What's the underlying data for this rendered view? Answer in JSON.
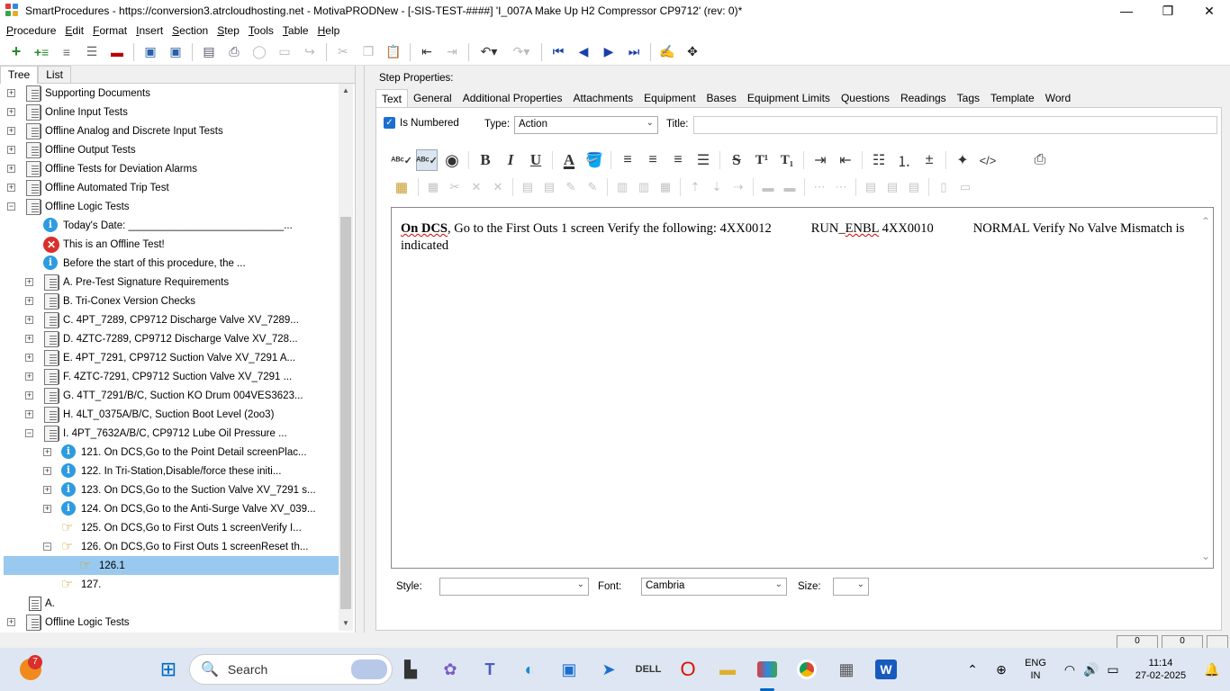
{
  "window": {
    "title": "SmartProcedures - https://conversion3.atrcloudhosting.net - MotivaPRODNew - [-SIS-TEST-####] 'I_007A Make Up H2 Compressor CP9712' (rev: 0)*",
    "minimize": "—",
    "maximize": "❐",
    "close": "✕"
  },
  "menu": {
    "items": [
      {
        "label": "Procedure"
      },
      {
        "label": "Edit"
      },
      {
        "label": "Format"
      },
      {
        "label": "Insert"
      },
      {
        "label": "Section"
      },
      {
        "label": "Step"
      },
      {
        "label": "Tools"
      },
      {
        "label": "Table"
      },
      {
        "label": "Help"
      }
    ]
  },
  "toolbar": {
    "icons": [
      "add-icon",
      "add-child-icon",
      "document-icon",
      "document-lines-icon",
      "remove-icon",
      "save-all-icon",
      "save-icon",
      "print-setup-icon",
      "print-icon",
      "refresh-icon",
      "window-icon",
      "redo-disabled-icon",
      "cut-icon",
      "copy-icon",
      "paste-icon",
      "indent-icon",
      "outdent-icon",
      "undo-icon",
      "redo-icon",
      "first-icon",
      "previous-icon",
      "next-icon",
      "last-icon",
      "spellcheck-icon",
      "move-icon"
    ]
  },
  "left_pane": {
    "tabs": [
      {
        "label": "Tree",
        "active": true
      },
      {
        "label": "List",
        "active": false
      }
    ],
    "tree": [
      {
        "label": "Supporting Documents",
        "level": 0,
        "icon": "document-stack-icon",
        "expander": "+"
      },
      {
        "label": "Online Input Tests",
        "level": 0,
        "icon": "document-stack-icon",
        "expander": "+"
      },
      {
        "label": "Offline Analog and Discrete Input Tests",
        "level": 0,
        "icon": "document-stack-icon",
        "expander": "+"
      },
      {
        "label": "Offline Output Tests",
        "level": 0,
        "icon": "document-stack-icon",
        "expander": "+"
      },
      {
        "label": "Offline Tests for Deviation Alarms",
        "level": 0,
        "icon": "document-stack-icon",
        "expander": "+"
      },
      {
        "label": "Offline Automated Trip Test",
        "level": 0,
        "icon": "document-stack-icon",
        "expander": "+"
      },
      {
        "label": "Offline Logic Tests",
        "level": 0,
        "icon": "document-stack-icon",
        "expander": "−"
      },
      {
        "label": "Today's Date: ___________________________...",
        "level": 1,
        "icon": "info-icon",
        "expander": ""
      },
      {
        "label": "This is an Offline Test!",
        "level": 1,
        "icon": "error-icon",
        "expander": ""
      },
      {
        "label": "Before the start of this procedure, the ...",
        "level": 1,
        "icon": "info-icon",
        "expander": ""
      },
      {
        "label": "A. Pre-Test Signature Requirements",
        "level": 1,
        "icon": "document-stack-icon",
        "expander": "+"
      },
      {
        "label": "B. Tri-Conex Version Checks",
        "level": 1,
        "icon": "document-stack-icon",
        "expander": "+"
      },
      {
        "label": "C. 4PT_7289, CP9712 Discharge Valve XV_7289...",
        "level": 1,
        "icon": "document-stack-icon",
        "expander": "+"
      },
      {
        "label": "D. 4ZTC-7289, CP9712 Discharge Valve XV_728...",
        "level": 1,
        "icon": "document-stack-icon",
        "expander": "+"
      },
      {
        "label": "E. 4PT_7291, CP9712 Suction Valve XV_7291 A...",
        "level": 1,
        "icon": "document-stack-icon",
        "expander": "+"
      },
      {
        "label": "F. 4ZTC-7291, CP9712 Suction Valve XV_7291 ...",
        "level": 1,
        "icon": "document-stack-icon",
        "expander": "+"
      },
      {
        "label": "G. 4TT_7291/B/C, Suction KO Drum 004VES3623...",
        "level": 1,
        "icon": "document-stack-icon",
        "expander": "+"
      },
      {
        "label": "H. 4LT_0375A/B/C, Suction Boot Level (2oo3)",
        "level": 1,
        "icon": "document-stack-icon",
        "expander": "+"
      },
      {
        "label": "I. 4PT_7632A/B/C, CP9712 Lube Oil Pressure ...",
        "level": 1,
        "icon": "document-stack-icon",
        "expander": "−"
      },
      {
        "label": "121. On DCS,Go to the Point Detail screenPlac...",
        "level": 2,
        "icon": "info-icon",
        "expander": "+"
      },
      {
        "label": "122. In Tri-Station,Disable/force these initi...",
        "level": 2,
        "icon": "info-icon",
        "expander": "+"
      },
      {
        "label": "123. On DCS,Go to the Suction Valve XV_7291 s...",
        "level": 2,
        "icon": "info-icon",
        "expander": "+"
      },
      {
        "label": "124. On DCS,Go to the Anti-Surge Valve XV_039...",
        "level": 2,
        "icon": "info-icon",
        "expander": "+"
      },
      {
        "label": "125. On DCS,Go to First Outs 1 screenVerify I...",
        "level": 2,
        "icon": "action-hand-icon",
        "expander": ""
      },
      {
        "label": "126. On DCS,Go to First Outs 1 screenReset th...",
        "level": 2,
        "icon": "action-hand-icon",
        "expander": "−"
      },
      {
        "label": "126.1",
        "level": 3,
        "icon": "action-hand-icon",
        "expander": "",
        "selected": true
      },
      {
        "label": "127.",
        "level": 2,
        "icon": "action-hand-icon",
        "expander": ""
      },
      {
        "label": "A.",
        "level": 0,
        "icon": "document-icon",
        "expander": ""
      },
      {
        "label": "Offline Logic Tests",
        "level": 0,
        "icon": "document-stack-icon",
        "expander": "+"
      }
    ]
  },
  "step_properties": {
    "label": "Step Properties:",
    "tabs": [
      {
        "label": "Text",
        "active": true
      },
      {
        "label": "General"
      },
      {
        "label": "Additional Properties"
      },
      {
        "label": "Attachments"
      },
      {
        "label": "Equipment"
      },
      {
        "label": "Bases"
      },
      {
        "label": "Equipment Limits"
      },
      {
        "label": "Questions"
      },
      {
        "label": "Readings"
      },
      {
        "label": "Tags"
      },
      {
        "label": "Template"
      },
      {
        "label": "Word"
      }
    ],
    "is_numbered": {
      "label": "Is Numbered",
      "checked": true
    },
    "type": {
      "label": "Type:",
      "value": "Action"
    },
    "title": {
      "label": "Title:",
      "value": ""
    },
    "editor_toolbar": {
      "bold": "B",
      "italic": "I",
      "underline": "U",
      "font_color": "A",
      "strike": "S",
      "superscript": "T¹",
      "subscript": "T₁",
      "code": "</>"
    },
    "editor": {
      "bold_lead": "On DCS",
      "text_after_lead": ", Go to the First Outs 1 screen Verify the following: 4XX0012",
      "run_prefix": "RUN_",
      "run_spell": "ENBL",
      "text_after_run": " 4XX0010",
      "text_normal": "NORMAL Verify No Valve Mismatch is indicated"
    },
    "style": {
      "label": "Style:",
      "value": ""
    },
    "font": {
      "label": "Font:",
      "value": "Cambria"
    },
    "size": {
      "label": "Size:",
      "value": ""
    }
  },
  "status_bar": {
    "cell1": "0",
    "cell2": "0"
  },
  "taskbar": {
    "search_placeholder": "Search",
    "notification_count": "7",
    "language": "ENG",
    "region": "IN",
    "time": "11:14",
    "date": "27-02-2025"
  }
}
